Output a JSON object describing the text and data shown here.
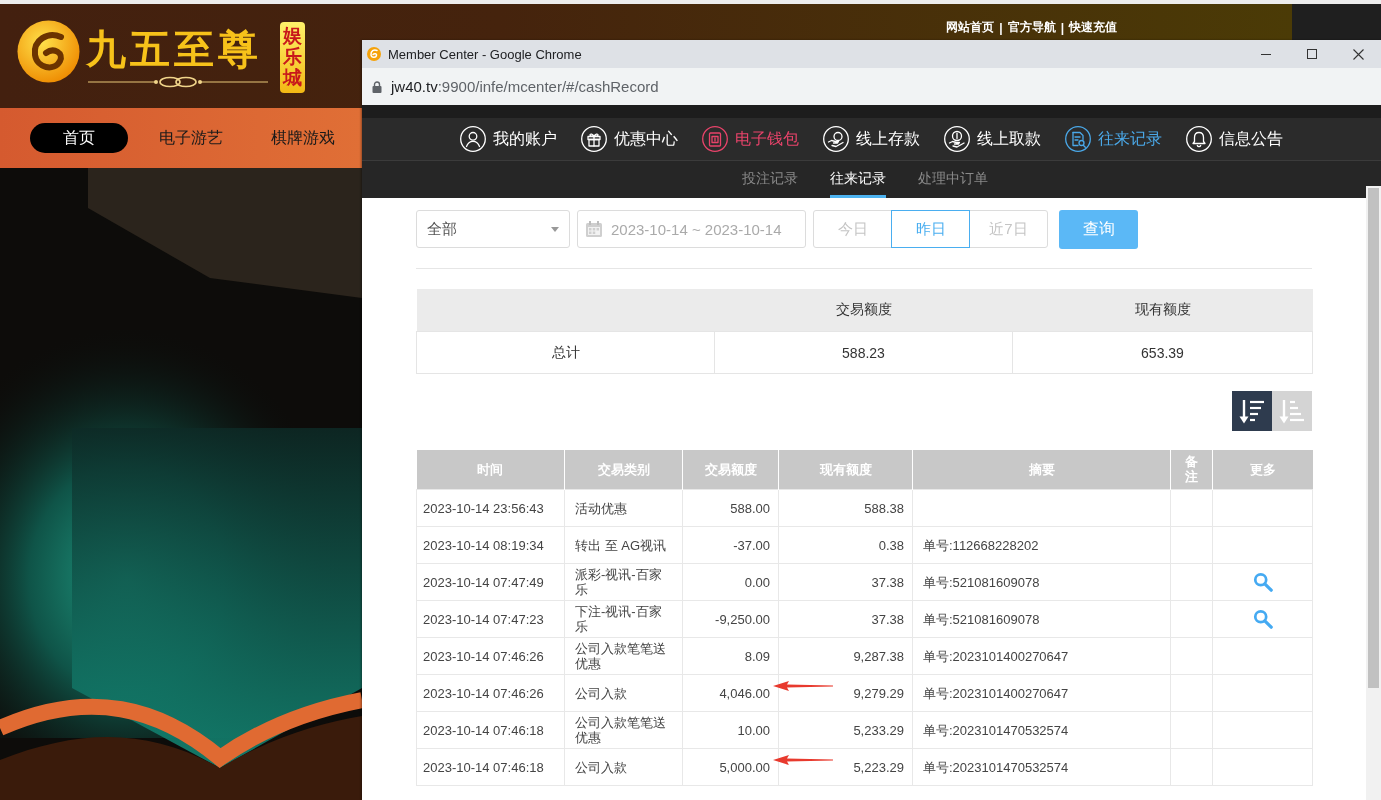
{
  "site": {
    "logo_title": "九五至尊",
    "logo_badge": "娱乐城",
    "top_links": [
      {
        "label": "网站首页",
        "separator": "|"
      },
      {
        "label": "官方导航",
        "separator": "|"
      },
      {
        "label": "快速充值"
      }
    ],
    "nav": [
      {
        "label": "首页",
        "selected": true
      },
      {
        "label": "电子游艺",
        "selected": false
      },
      {
        "label": "棋牌游戏",
        "selected": false
      }
    ]
  },
  "browser": {
    "title": "Member Center - Google Chrome",
    "url_host": "jw40.tv",
    "url_path": ":9900/infe/mcenter/#/cashRecord"
  },
  "member_nav": [
    {
      "label": "我的账户",
      "selected": false,
      "highlighted": false
    },
    {
      "label": "优惠中心",
      "selected": false,
      "highlighted": false
    },
    {
      "label": "电子钱包",
      "selected": false,
      "highlighted": true
    },
    {
      "label": "线上存款",
      "selected": false,
      "highlighted": false
    },
    {
      "label": "线上取款",
      "selected": false,
      "highlighted": false
    },
    {
      "label": "往来记录",
      "selected": true,
      "highlighted": false
    },
    {
      "label": "信息公告",
      "selected": false,
      "highlighted": false
    }
  ],
  "sub_tabs": [
    {
      "label": "投注记录",
      "selected": false
    },
    {
      "label": "往来记录",
      "selected": true
    },
    {
      "label": "处理中订单",
      "selected": false
    }
  ],
  "filters": {
    "type_select": {
      "value": "全部"
    },
    "date_range": {
      "value": "2023-10-14 ~ 2023-10-14"
    },
    "quick_ranges": [
      {
        "label": "今日",
        "selected": false
      },
      {
        "label": "昨日",
        "selected": true
      },
      {
        "label": "近7日",
        "selected": false
      }
    ],
    "query_button": "查询"
  },
  "summary": {
    "columns": [
      "交易额度",
      "现有额度"
    ],
    "row": {
      "label": "总计",
      "values": [
        "588.23",
        "653.39"
      ]
    }
  },
  "sort_buttons": [
    {
      "kind": "descending",
      "selected": true
    },
    {
      "kind": "ascending",
      "selected": false
    }
  ],
  "records": {
    "columns": [
      "时间",
      "交易类别",
      "交易额度",
      "现有额度",
      "摘要",
      "备注",
      "更多"
    ],
    "rows": [
      {
        "time": "2023-10-14 23:56:43",
        "type": "活动优惠",
        "amount": "588.00",
        "balance": "588.38",
        "has_detail": false,
        "annotated": false
      },
      {
        "time": "2023-10-14 08:19:34",
        "type": "转出 至 AG视讯",
        "amount": "-37.00",
        "balance": "0.38",
        "summary": "单号:112668228202",
        "has_detail": false,
        "annotated": false
      },
      {
        "time": "2023-10-14 07:47:49",
        "type": "派彩-视讯-百家乐",
        "amount": "0.00",
        "balance": "37.38",
        "summary": "单号:521081609078",
        "has_detail": true,
        "annotated": false
      },
      {
        "time": "2023-10-14 07:47:23",
        "type": "下注-视讯-百家乐",
        "amount": "-9,250.00",
        "balance": "37.38",
        "summary": "单号:521081609078",
        "has_detail": true,
        "annotated": false
      },
      {
        "time": "2023-10-14 07:46:26",
        "type": "公司入款笔笔送优惠",
        "amount": "8.09",
        "balance": "9,287.38",
        "summary": "单号:2023101400270647",
        "has_detail": false,
        "annotated": false
      },
      {
        "time": "2023-10-14 07:46:26",
        "type": "公司入款",
        "amount": "4,046.00",
        "balance": "9,279.29",
        "summary": "单号:2023101400270647",
        "has_detail": false,
        "annotated": true
      },
      {
        "time": "2023-10-14 07:46:18",
        "type": "公司入款笔笔送优惠",
        "amount": "10.00",
        "balance": "5,233.29",
        "summary": "单号:2023101470532574",
        "has_detail": false,
        "annotated": false
      },
      {
        "time": "2023-10-14 07:46:18",
        "type": "公司入款",
        "amount": "5,000.00",
        "balance": "5,223.29",
        "summary": "单号:2023101470532574",
        "has_detail": false,
        "annotated": true
      }
    ]
  }
}
